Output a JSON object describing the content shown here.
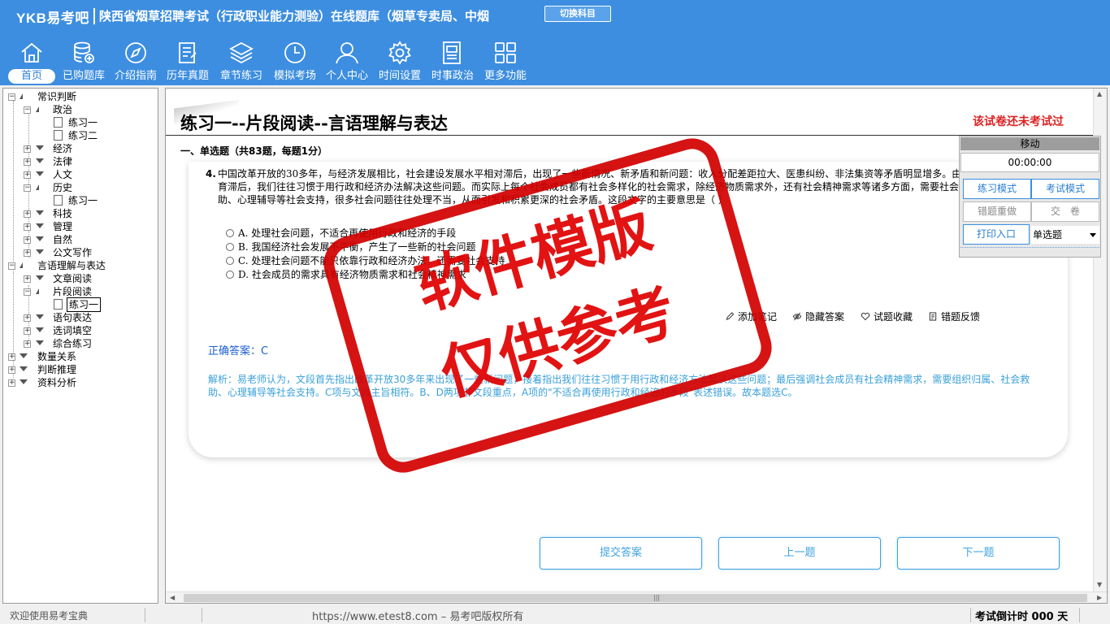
{
  "header": {
    "brand": "YKB易考吧",
    "title": "陕西省烟草招聘考试（行政职业能力测验）在线题库（烟草专卖局、中烟",
    "switch_label": "切换科目"
  },
  "nav": [
    {
      "label": "首页",
      "icon": "home-icon"
    },
    {
      "label": "已购题库",
      "icon": "database-icon"
    },
    {
      "label": "介绍指南",
      "icon": "compass-icon"
    },
    {
      "label": "历年真题",
      "icon": "exam-paper-icon"
    },
    {
      "label": "章节练习",
      "icon": "layers-icon"
    },
    {
      "label": "模拟考场",
      "icon": "clock-icon"
    },
    {
      "label": "个人中心",
      "icon": "user-icon"
    },
    {
      "label": "时间设置",
      "icon": "gear-icon"
    },
    {
      "label": "时事政治",
      "icon": "news-icon"
    },
    {
      "label": "更多功能",
      "icon": "grid-icon"
    }
  ],
  "tree": [
    {
      "label": "常识判断"
    },
    {
      "label": "政治"
    },
    {
      "label": "练习一"
    },
    {
      "label": "练习二"
    },
    {
      "label": "经济"
    },
    {
      "label": "法律"
    },
    {
      "label": "人文"
    },
    {
      "label": "历史"
    },
    {
      "label": "练习一"
    },
    {
      "label": "科技"
    },
    {
      "label": "管理"
    },
    {
      "label": "自然"
    },
    {
      "label": "公文写作"
    },
    {
      "label": "言语理解与表达"
    },
    {
      "label": "文章阅读"
    },
    {
      "label": "片段阅读"
    },
    {
      "label": "练习一"
    },
    {
      "label": "语句表达"
    },
    {
      "label": "选词填空"
    },
    {
      "label": "综合练习"
    },
    {
      "label": "数量关系"
    },
    {
      "label": "判断推理"
    },
    {
      "label": "资料分析"
    }
  ],
  "page": {
    "title": "练习一--片段阅读--言语理解与表达",
    "exam_status": "该试卷还未考试过",
    "section": "一、单选题（共83题，每题1分）"
  },
  "question": {
    "number": "4.",
    "text": "中国改革开放的30多年，与经济发展相比，社会建设发展水平相对滞后，出现了一些新情况、新矛盾和新问题：收入分配差距拉大、医患纠纷、非法集资等矛盾明显增多。由于社会组织等发育滞后，我们往往习惯于用行政和经济办法解决这些问题。而实际上每个社会成员都有社会多样化的社会需求，除经济物质需求外，还有社会精神需求等诸多方面，需要社会组织归属、社会救助、心理辅导等社会支持，很多社会问题往往处理不当，从而引发和积累更深的社会矛盾。这段文字的主要意思是（ ）",
    "options": [
      "A. 处理社会问题，不适合再使用行政和经济的手段",
      "B. 我国经济社会发展不平衡，产生了一些新的社会问题",
      "C. 处理社会问题不能只依靠行政和经济办法，还需要社会支持",
      "D. 社会成员的需求具有经济物质需求和社会精神需求"
    ],
    "actions": [
      "添加笔记",
      "隐藏答案",
      "试题收藏",
      "错题反馈"
    ],
    "answer": "正确答案：C",
    "analysis": "解析：易老师认为，文段首先指出改革开放30多年来出现了一些新问题，接着指出我们往往习惯于用行政和经济方法解决这些问题；最后强调社会成员有社会精神需求，需要组织归属、社会救助、心理辅导等社会支持。C项与文段主旨相符。B、D两项非文段重点，A项的\"不适合再使用行政和经济的手段\"表述错误。故本题选C。"
  },
  "buttons": {
    "submit": "提交答案",
    "prev": "上一题",
    "next": "下一题"
  },
  "panel": {
    "move": "移动",
    "timer": "00:00:00",
    "practice_mode": "练习模式",
    "exam_mode": "考试模式",
    "redo_wrong": "错题重做",
    "hand_in": "交　卷",
    "print": "打印入口",
    "type_select": "单选题"
  },
  "statusbar": {
    "welcome": "欢迎使用易考宝典",
    "copyright": "https://www.etest8.com – 易考吧版权所有",
    "countdown": "考试倒计时 000 天"
  },
  "watermark": {
    "line1": "软件模版",
    "line2": "仅供参考"
  },
  "colors": {
    "header_bg": "#3d8ee0",
    "accent_blue": "#3fa3df",
    "status_red": "#d22222",
    "watermark_red": "#e00000"
  }
}
